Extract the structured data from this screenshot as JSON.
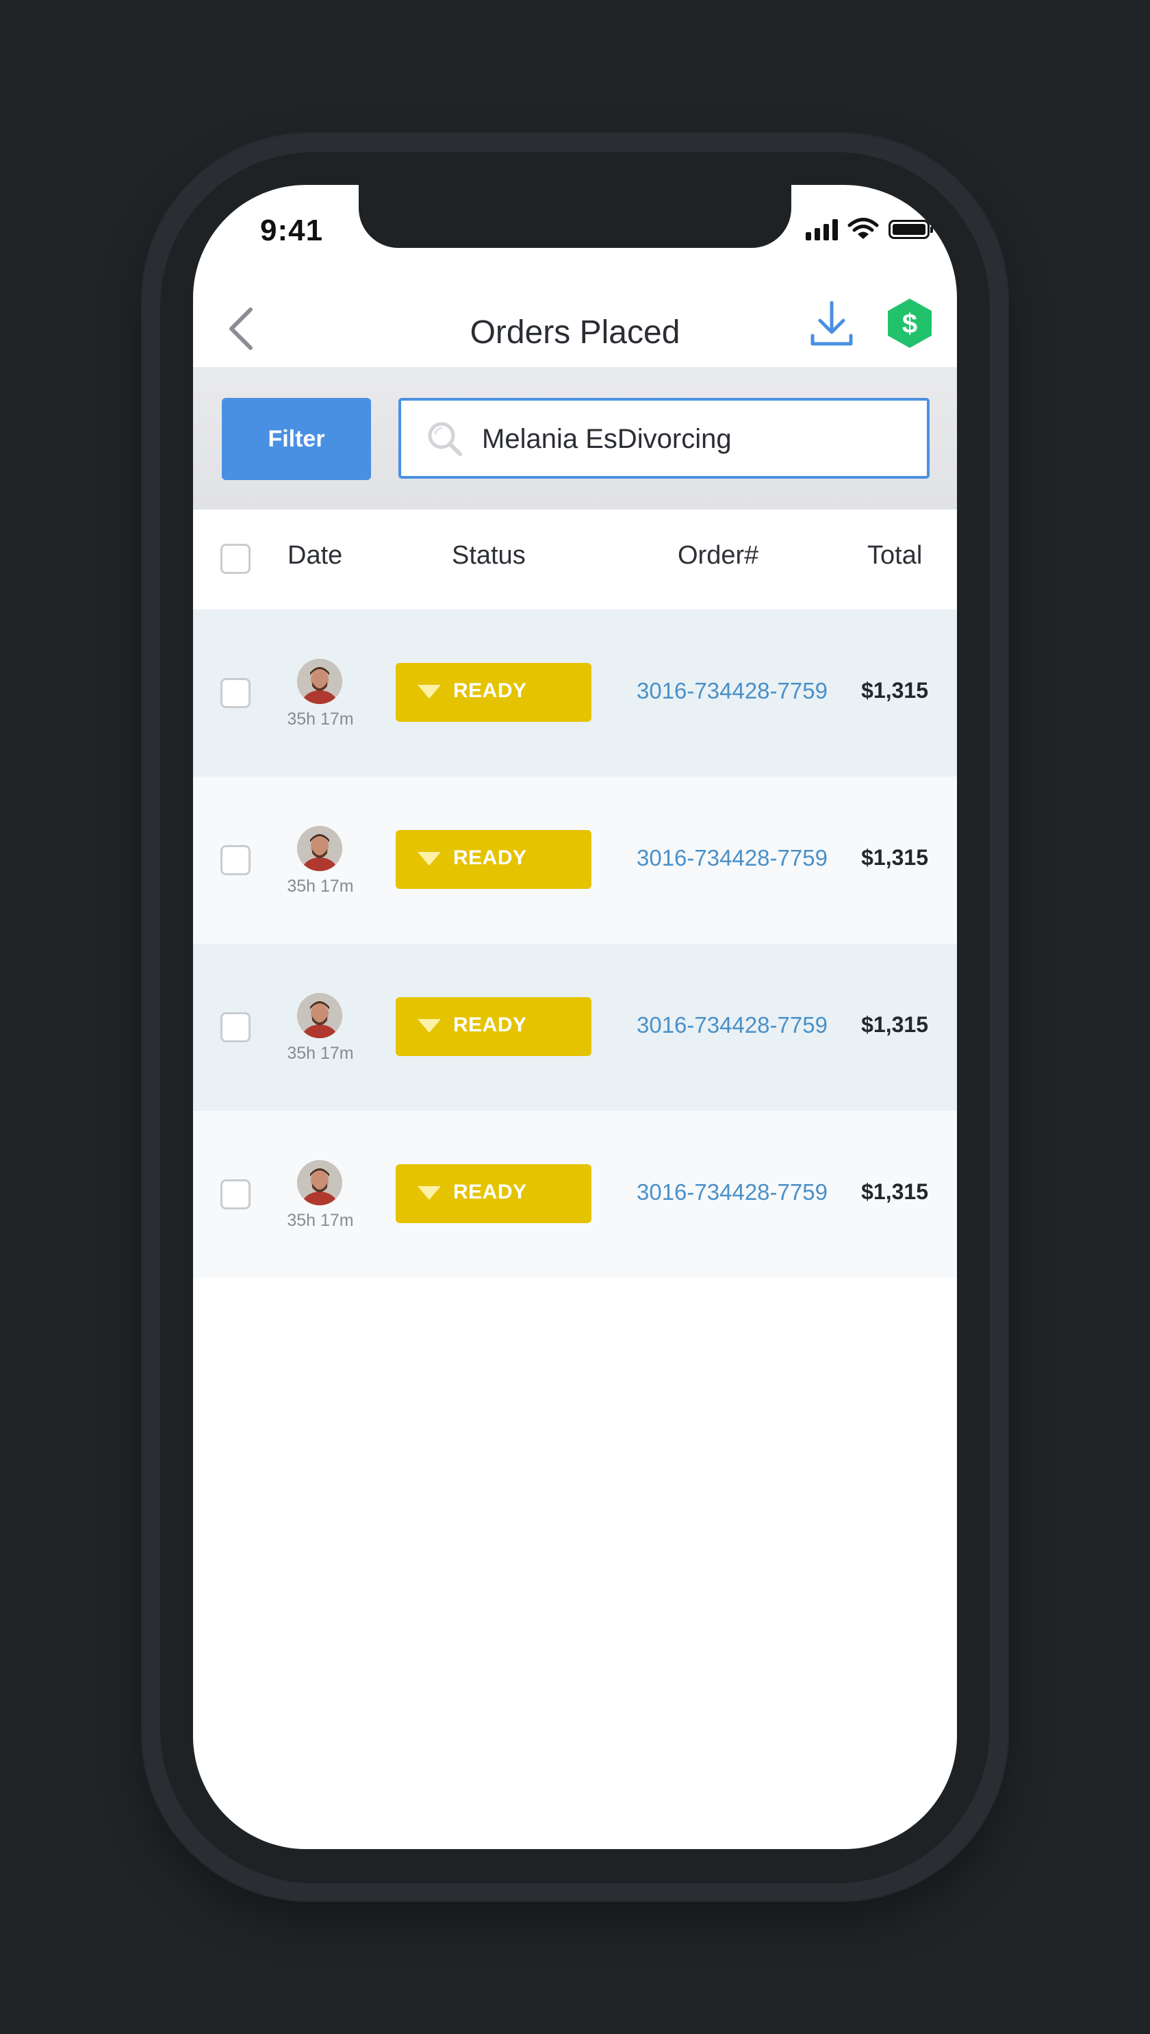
{
  "status_bar": {
    "time": "9:41"
  },
  "header": {
    "title": "Orders Placed"
  },
  "filter": {
    "button_label": "Filter",
    "search_value": "Melania EsDivorcing"
  },
  "table": {
    "columns": [
      "Date",
      "Status",
      "Order#",
      "Total"
    ],
    "rows": [
      {
        "date": "35h 17m",
        "status": "READY",
        "order": "3016-734428-7759",
        "total": "$1,315"
      },
      {
        "date": "35h 17m",
        "status": "READY",
        "order": "3016-734428-7759",
        "total": "$1,315"
      },
      {
        "date": "35h 17m",
        "status": "READY",
        "order": "3016-734428-7759",
        "total": "$1,315"
      },
      {
        "date": "35h 17m",
        "status": "READY",
        "order": "3016-734428-7759",
        "total": "$1,315"
      }
    ]
  },
  "colors": {
    "accent": "#4a90e2",
    "status_ready": "#e5c300",
    "money_badge": "#21c26b",
    "link": "#4a90c8"
  }
}
